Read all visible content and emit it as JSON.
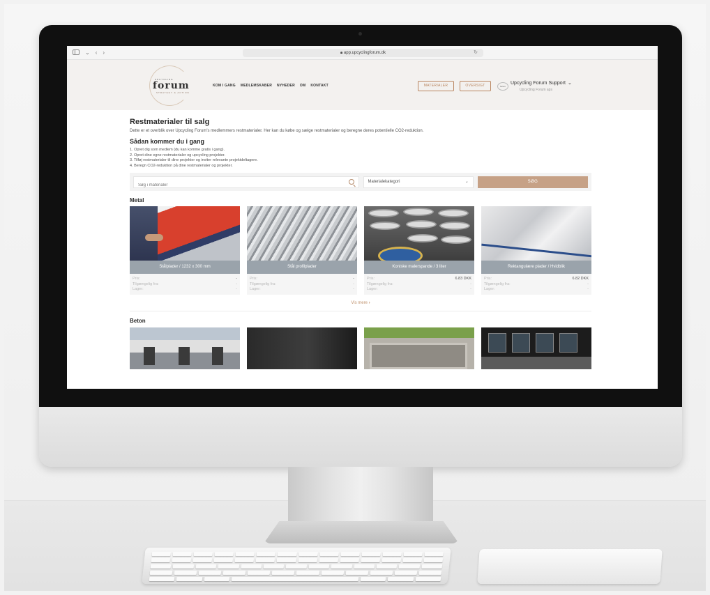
{
  "browser": {
    "url": "app.upcyclingforum.dk"
  },
  "logo": {
    "top": "UPCYCLING",
    "word": "forum",
    "sub": "STRATEGY & ACTION"
  },
  "nav": {
    "items": [
      "KOM I GANG",
      "MEDLEMSKABER",
      "NYHEDER",
      "OM",
      "KONTAKT"
    ]
  },
  "header_buttons": {
    "materialer": "MATERIALER",
    "oversigt": "OVERSIGT"
  },
  "user": {
    "logo_text": "forum",
    "name": "Upcycling Forum Support",
    "org": "Upcycling Forum aps"
  },
  "page": {
    "title": "Restmaterialer til salg",
    "intro": "Dette er et overblik over Upcycling Forum's medlemmers restmaterialer. Her kan du købe og sælge restmaterialer og beregne deres potentielle CO2-reduktion.",
    "how_title": "Sådan kommer du i gang",
    "steps": [
      "1. Opret dig som medlem (du kan komme gratis i gang).",
      "2. Opret dine egne restmaterialer og upcycling projekter.",
      "3. Tilføj restmaterialer til dine projekter og inviter relevante projektdeltagere.",
      "4. Beregn CO2-reduktion på dine restmaterialer og projekter."
    ]
  },
  "search": {
    "placeholder": "Søg i materialer",
    "category": "Materialekategori",
    "button": "SØG"
  },
  "labels": {
    "price": "Pris:",
    "available": "Tilgængelig fra:",
    "stock": "Lager:"
  },
  "sections": [
    {
      "title": "Metal",
      "cards": [
        {
          "title": "Stålplader / 1232 x 300 mm",
          "price": "-",
          "available": "-",
          "stock": "-"
        },
        {
          "title": "Stål profilplader",
          "price": "-",
          "available": "-",
          "stock": "-"
        },
        {
          "title": "Koniske malerspande / 3 liter",
          "price": "6.83 DKK",
          "available": "-",
          "stock": "-"
        },
        {
          "title": "Rektangulære plader / Hvidblik",
          "price": "6.82 DKK",
          "available": "-",
          "stock": "-"
        }
      ],
      "more": "Vis mere"
    },
    {
      "title": "Beton"
    }
  ],
  "colors": {
    "accent": "#c6a186",
    "card_title_bg": "#9aa3ab"
  }
}
